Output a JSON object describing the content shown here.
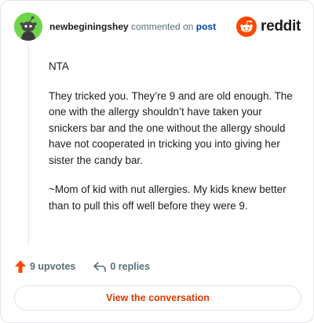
{
  "comment": {
    "username": "newbeginingshey",
    "action_text": "commented on",
    "post_link": "post",
    "paragraphs": [
      "NTA",
      "They tricked you. They’re 9 and are old enough. The one with the allergy shouldn’t have taken your snickers bar and the one without the allergy should have not cooperated in tricking you into giving her sister the candy bar.",
      "~Mom of kid with nut allergies. My kids knew better than to pull this off well before they were 9."
    ],
    "upvotes_label": "9 upvotes",
    "replies_label": "0 replies"
  },
  "brand": {
    "name": "reddit",
    "accent": "#ff4500"
  },
  "cta": {
    "label": "View the conversation"
  },
  "icons": {
    "avatar": "snoo-avatar-icon",
    "logo": "reddit-snoo-icon",
    "upvote": "upvote-arrow-icon",
    "reply": "reply-arrow-icon"
  },
  "colors": {
    "avatar_bg": "#6fd44a",
    "link": "#0045ac",
    "cta_text": "#d93a00",
    "muted": "#576f76"
  }
}
